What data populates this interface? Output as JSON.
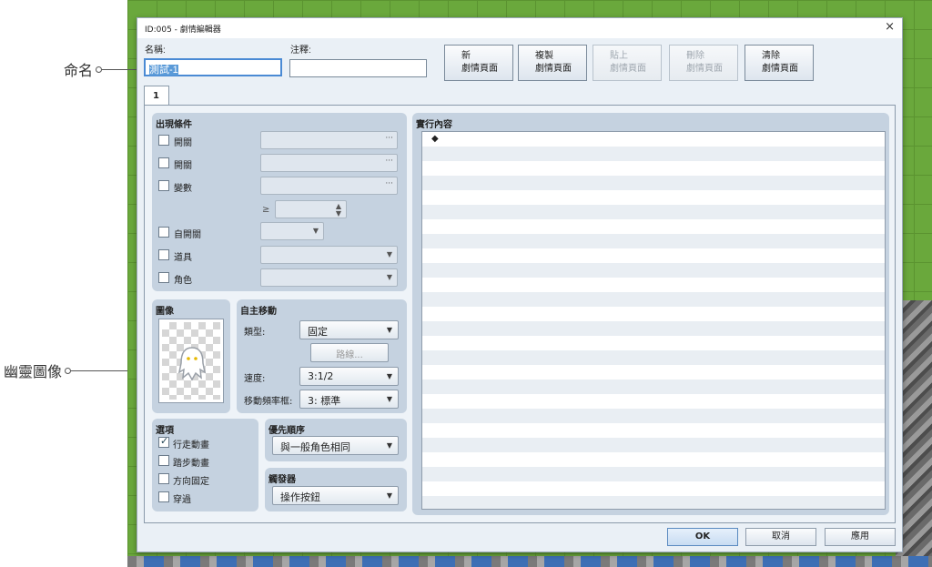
{
  "window": {
    "title": "ID:005 - 劇情編輯器",
    "close_symbol": "×"
  },
  "callouts": {
    "name": "命名",
    "ghost": "幽靈圖像"
  },
  "form": {
    "name_label": "名稱:",
    "name_value": "測試-1",
    "note_label": "注釋:",
    "note_value": ""
  },
  "toolbar": [
    {
      "line1": "新",
      "line2": "劇情頁面",
      "enabled": true
    },
    {
      "line1": "複製",
      "line2": "劇情頁面",
      "enabled": true
    },
    {
      "line1": "貼上",
      "line2": "劇情頁面",
      "enabled": false
    },
    {
      "line1": "刪除",
      "line2": "劇情頁面",
      "enabled": false
    },
    {
      "line1": "清除",
      "line2": "劇情頁面",
      "enabled": true
    }
  ],
  "tabs": [
    {
      "label": "1",
      "active": true
    }
  ],
  "conditions": {
    "title": "出現條件",
    "switch1": "開關",
    "switch2": "開關",
    "variable": "變數",
    "ge_symbol": "≥",
    "self_switch": "自開關",
    "item": "道具",
    "actor": "角色",
    "ellipsis": "···"
  },
  "image": {
    "title": "圖像"
  },
  "autonomous": {
    "title": "自主移動",
    "type_label": "類型:",
    "type_value": "固定",
    "route_button": "路線...",
    "speed_label": "速度:",
    "speed_value": "3:1/2",
    "freq_label": "移動頻率框:",
    "freq_value": "3: 標準"
  },
  "options": {
    "title": "選項",
    "items": [
      {
        "label": "行走動畫",
        "checked": true
      },
      {
        "label": "踏步動畫",
        "checked": false
      },
      {
        "label": "方向固定",
        "checked": false
      },
      {
        "label": "穿過",
        "checked": false
      }
    ]
  },
  "priority": {
    "title": "優先順序",
    "value": "與一般角色相同"
  },
  "trigger": {
    "title": "觸發器",
    "value": "操作按鈕"
  },
  "contents": {
    "title": "實行內容",
    "first_row_marker": "◆"
  },
  "footer": {
    "ok": "OK",
    "cancel": "取消",
    "apply": "應用"
  }
}
